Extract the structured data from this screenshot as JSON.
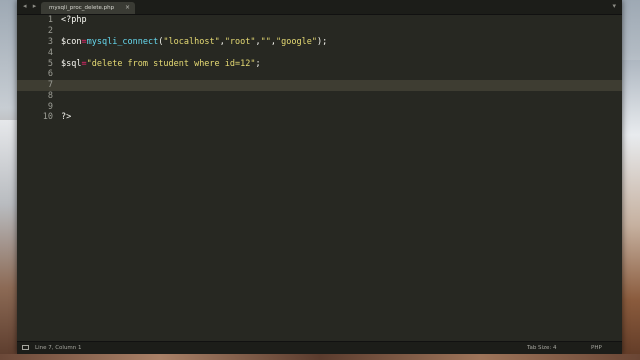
{
  "window": {
    "tab_title": "mysqli_proc_delete.php",
    "nav_arrows": "◂ ▸",
    "tab_close": "×",
    "menu_glyph": "▾"
  },
  "editor": {
    "line_numbers": [
      "1",
      "2",
      "3",
      "4",
      "5",
      "6",
      "7",
      "8",
      "9",
      "10"
    ],
    "active_line": "7",
    "code": {
      "l1": "<?php",
      "l3_var": "$con",
      "l3_op": "=",
      "l3_fn": "mysqli_connect",
      "l3_open": "(",
      "l3_arg1": "\"localhost\"",
      "l3_c1": ",",
      "l3_arg2": "\"root\"",
      "l3_c2": ",",
      "l3_arg3": "\"\"",
      "l3_c3": ",",
      "l3_arg4": "\"google\"",
      "l3_close": ");",
      "l5_var": "$sql",
      "l5_op": "=",
      "l5_str": "\"delete from student where id=12\"",
      "l5_end": ";",
      "l10": "?>"
    }
  },
  "statusbar": {
    "position": "Line 7, Column 1",
    "tab_size": "Tab Size: 4",
    "syntax": "PHP"
  },
  "colors": {
    "background": "#272822",
    "keyword": "#f92672",
    "function": "#66d9ef",
    "string": "#e6db74"
  }
}
